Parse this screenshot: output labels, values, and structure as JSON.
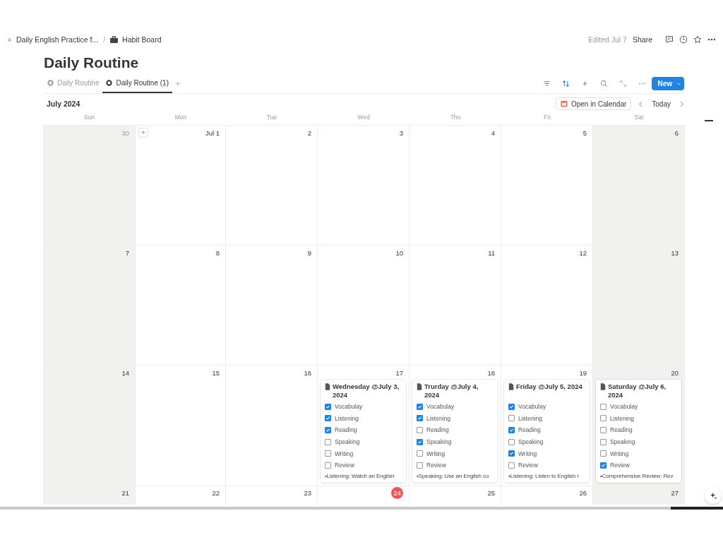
{
  "breadcrumb": [
    {
      "label": "Daily English Practice f..."
    },
    {
      "label": "Habit Board"
    }
  ],
  "breadcrumb_separator": "/",
  "header_actions": {
    "edited": "Edited Jul 7",
    "share": "Share"
  },
  "title": "Daily Routine",
  "tabs": [
    {
      "label": "Daily Routine",
      "selected": false
    },
    {
      "label": "Daily Routine (1)",
      "selected": true
    }
  ],
  "add_view": "+",
  "new_button": "New",
  "month": "July 2024",
  "open_in_calendar": "Open in Calendar",
  "today_button": "Today",
  "weekdays": [
    "Sun",
    "Mon",
    "Tue",
    "Wed",
    "Thu",
    "Fri",
    "Sat"
  ],
  "weeks": [
    {
      "days": [
        {
          "label": "30",
          "muted": true,
          "today": false
        },
        {
          "label": "Jul 1",
          "muted": false,
          "today": false,
          "add": "+"
        },
        {
          "label": "2",
          "muted": false,
          "today": false
        },
        {
          "label": "3",
          "muted": false,
          "today": false
        },
        {
          "label": "4",
          "muted": false,
          "today": false
        },
        {
          "label": "5",
          "muted": false,
          "today": false
        },
        {
          "label": "6",
          "muted": false,
          "today": false
        }
      ]
    },
    {
      "days": [
        {
          "label": "7",
          "muted": false,
          "today": false
        },
        {
          "label": "8",
          "muted": false,
          "today": false
        },
        {
          "label": "9",
          "muted": false,
          "today": false
        },
        {
          "label": "10",
          "muted": false,
          "today": false
        },
        {
          "label": "11",
          "muted": false,
          "today": false
        },
        {
          "label": "12",
          "muted": false,
          "today": false
        },
        {
          "label": "13",
          "muted": false,
          "today": false
        }
      ]
    },
    {
      "days": [
        {
          "label": "14",
          "muted": false,
          "today": false
        },
        {
          "label": "15",
          "muted": false,
          "today": false
        },
        {
          "label": "16",
          "muted": false,
          "today": false
        },
        {
          "label": "17",
          "muted": false,
          "today": false,
          "card": {
            "title": "Wednesday @July 3, 2024",
            "tasks": [
              {
                "label": "Vocabulay",
                "checked": true
              },
              {
                "label": "Listening",
                "checked": true
              },
              {
                "label": "Reading",
                "checked": true
              },
              {
                "label": "Speaking",
                "checked": false
              },
              {
                "label": "Writing",
                "checked": false
              },
              {
                "label": "Review",
                "checked": false
              }
            ],
            "note": "•Listening: Watch an English"
          }
        },
        {
          "label": "18",
          "muted": false,
          "today": false,
          "card": {
            "title": "Trurday @July 4, 2024",
            "tasks": [
              {
                "label": "Vocabulay",
                "checked": true
              },
              {
                "label": "Listening",
                "checked": true
              },
              {
                "label": "Reading",
                "checked": false
              },
              {
                "label": "Speaking",
                "checked": true
              },
              {
                "label": "Writing",
                "checked": false
              },
              {
                "label": "Review",
                "checked": false
              }
            ],
            "note": "•Speaking: Use an English co"
          }
        },
        {
          "label": "19",
          "muted": false,
          "today": false,
          "card": {
            "title": "Friday @July 5, 2024",
            "tasks": [
              {
                "label": "Vocabulay",
                "checked": true
              },
              {
                "label": "Listening",
                "checked": false
              },
              {
                "label": "Reading",
                "checked": true
              },
              {
                "label": "Speaking",
                "checked": false
              },
              {
                "label": "Writing",
                "checked": true
              },
              {
                "label": "Review",
                "checked": false
              }
            ],
            "note": "•Listening: Listen to English r"
          }
        },
        {
          "label": "20",
          "muted": false,
          "today": false,
          "card": {
            "title": "Saturday @July 6, 2024",
            "tasks": [
              {
                "label": "Vocabulay",
                "checked": false
              },
              {
                "label": "Listening",
                "checked": false
              },
              {
                "label": "Reading",
                "checked": false
              },
              {
                "label": "Speaking",
                "checked": false
              },
              {
                "label": "Writing",
                "checked": false
              },
              {
                "label": "Review",
                "checked": true
              }
            ],
            "note": "•Comprehensive Review: Rev"
          }
        }
      ]
    },
    {
      "days": [
        {
          "label": "21",
          "muted": false,
          "today": false
        },
        {
          "label": "22",
          "muted": false,
          "today": false
        },
        {
          "label": "23",
          "muted": false,
          "today": false
        },
        {
          "label": "24",
          "muted": false,
          "today": true
        },
        {
          "label": "25",
          "muted": false,
          "today": false
        },
        {
          "label": "26",
          "muted": false,
          "today": false
        },
        {
          "label": "27",
          "muted": false,
          "today": false
        }
      ]
    }
  ]
}
